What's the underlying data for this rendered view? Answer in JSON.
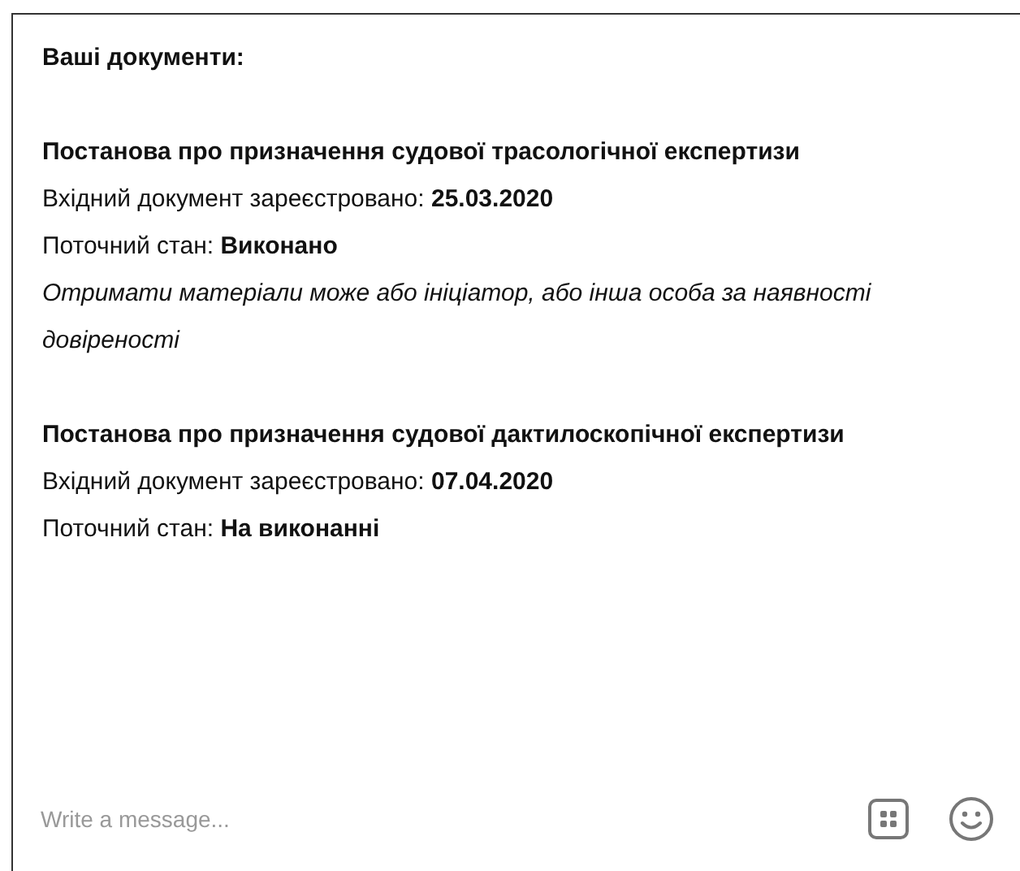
{
  "heading": "Ваші документи:",
  "documents": [
    {
      "title": "Постанова про призначення судової трасологічної експертизи",
      "registered": "Вхідний документ зареєстровано: **25.03.2020**",
      "status": "Поточний стан: **Виконано**",
      "note": "Отримати матеріали може або ініціатор, або інша особа за наявності довіреності"
    },
    {
      "title": "Постанова про призначення судової дактилоскопічної експертизи",
      "registered": "Вхідний документ зареєстровано: **07.04.2020**",
      "status": "Поточний стан: **На виконанні**"
    }
  ],
  "composer": {
    "placeholder": "Write a message..."
  }
}
